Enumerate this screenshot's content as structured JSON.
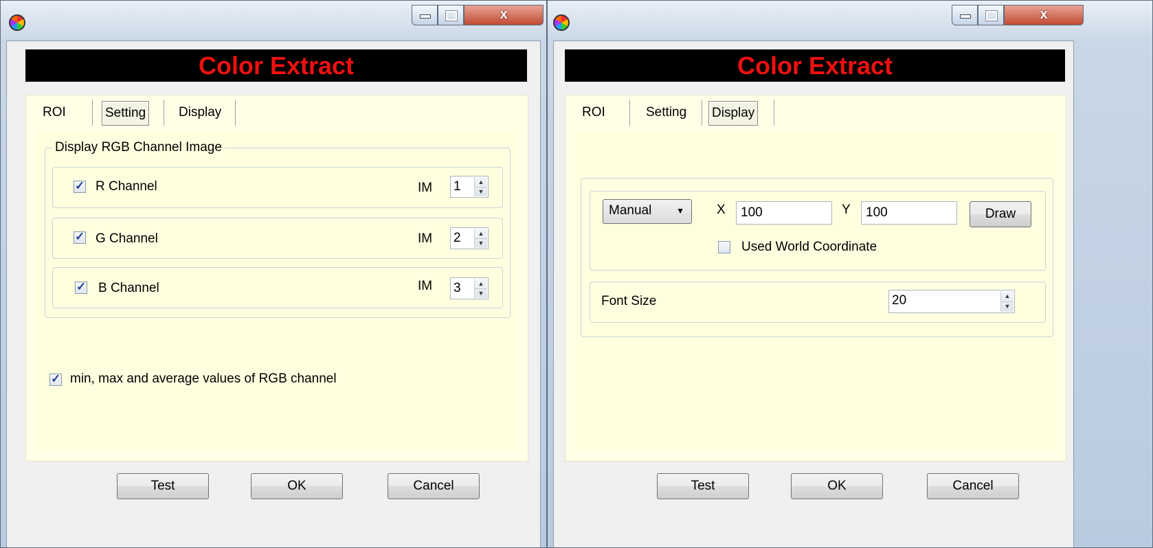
{
  "left_window": {
    "banner": "Color Extract",
    "tabs": [
      "ROI",
      "Setting",
      "Display"
    ],
    "active_tab": "Setting",
    "group_title": "Display RGB Channel Image",
    "channels": [
      {
        "label": "R Channel",
        "checked": true,
        "im_label": "IM",
        "value": "1"
      },
      {
        "label": "G Channel",
        "checked": true,
        "im_label": "IM",
        "value": "2"
      },
      {
        "label": "B Channel",
        "checked": true,
        "im_label": "IM",
        "value": "3"
      }
    ],
    "stats_checkbox": {
      "label": "min, max and average values of RGB channel",
      "checked": true
    },
    "buttons": {
      "test": "Test",
      "ok": "OK",
      "cancel": "Cancel"
    },
    "close_glyph": "x"
  },
  "right_window": {
    "banner": "Color Extract",
    "tabs": [
      "ROI",
      "Setting",
      "Display"
    ],
    "active_tab": "Display",
    "mode_select": "Manual",
    "x_label": "X",
    "x_value": "100",
    "y_label": "Y",
    "y_value": "100",
    "draw_button": "Draw",
    "world_coord": {
      "label": "Used World Coordinate",
      "checked": false
    },
    "font_size_label": "Font Size",
    "font_size_value": "20",
    "buttons": {
      "test": "Test",
      "ok": "OK",
      "cancel": "Cancel"
    },
    "close_glyph": "x"
  }
}
